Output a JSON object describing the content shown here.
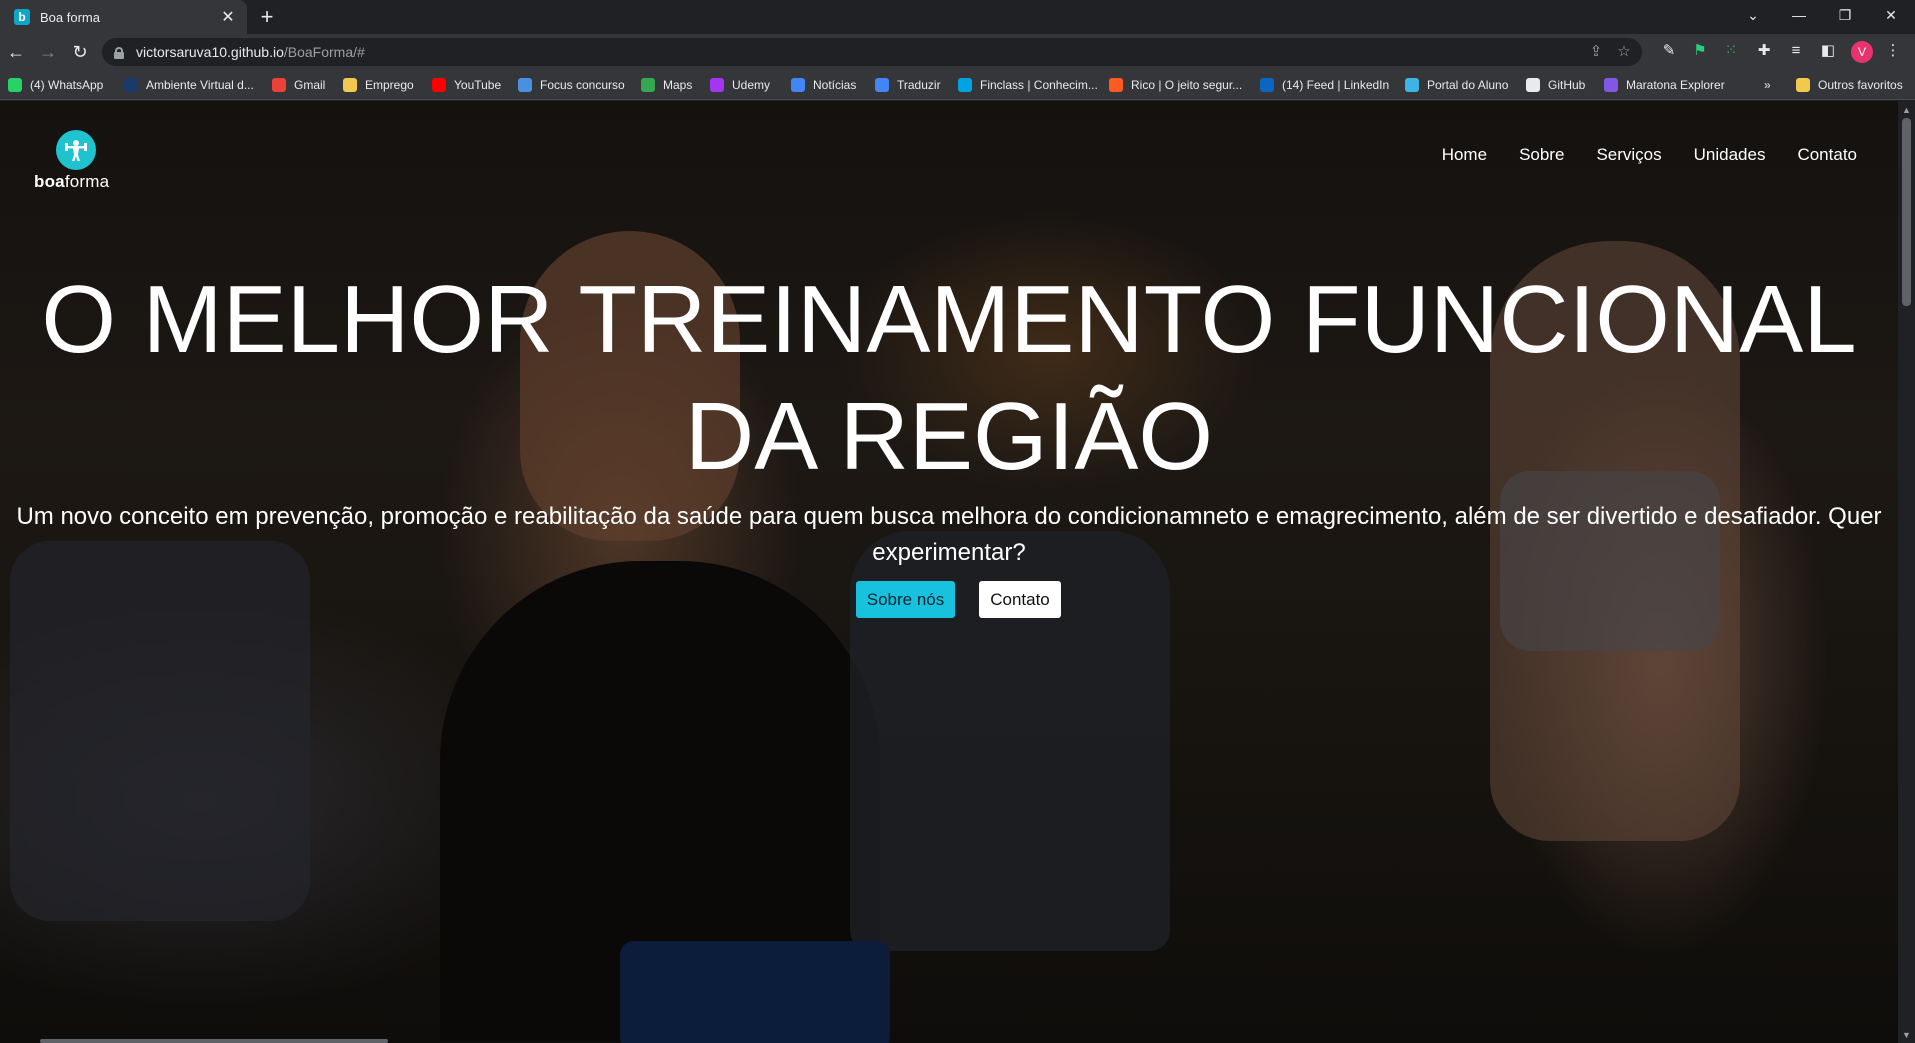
{
  "browser": {
    "tab_title": "Boa forma",
    "tab_favicon_letter": "b",
    "url_host": "victorsaruva10.github.io",
    "url_path": "/BoaForma/#",
    "profile_initial": "V"
  },
  "bookmarks": [
    {
      "label": "(4) WhatsApp",
      "icon_color": "#25d366"
    },
    {
      "label": "Ambiente Virtual d...",
      "icon_color": "#1a3a6b"
    },
    {
      "label": "Gmail",
      "icon_color": "#ea4335"
    },
    {
      "label": "Emprego",
      "icon_color": "#f2c94c"
    },
    {
      "label": "YouTube",
      "icon_color": "#ff0000"
    },
    {
      "label": "Focus concurso",
      "icon_color": "#4a90e2"
    },
    {
      "label": "Maps",
      "icon_color": "#34a853"
    },
    {
      "label": "Udemy",
      "icon_color": "#a435f0"
    },
    {
      "label": "Notícias",
      "icon_color": "#4285f4"
    },
    {
      "label": "Traduzir",
      "icon_color": "#4285f4"
    },
    {
      "label": "Finclass | Conhecim...",
      "icon_color": "#00a3e0"
    },
    {
      "label": "Rico | O jeito segur...",
      "icon_color": "#ff5a1f"
    },
    {
      "label": "(14) Feed | LinkedIn",
      "icon_color": "#0a66c2"
    },
    {
      "label": "Portal do Aluno",
      "icon_color": "#3db4e5"
    },
    {
      "label": "GitHub",
      "icon_color": "#e8eaed"
    },
    {
      "label": "Maratona Explorer",
      "icon_color": "#8257e6"
    }
  ],
  "bookmarks_more": "»",
  "bookmarks_other": "Outros favoritos",
  "site": {
    "logo_bold": "boa",
    "logo_rest": "forma",
    "nav": [
      "Home",
      "Sobre",
      "Serviços",
      "Unidades",
      "Contato"
    ],
    "hero_title": "O MELHOR TREINAMENTO FUNCIONAL DA REGIÃO",
    "hero_subtitle": "Um novo conceito em prevenção, promoção e reabilitação da saúde para quem busca melhora do condicionamneto e emagrecimento, além de ser divertido e desafiador. Quer experimentar?",
    "btn_about": "Sobre nós",
    "btn_contact": "Contato",
    "accent_color": "#18c2de"
  }
}
